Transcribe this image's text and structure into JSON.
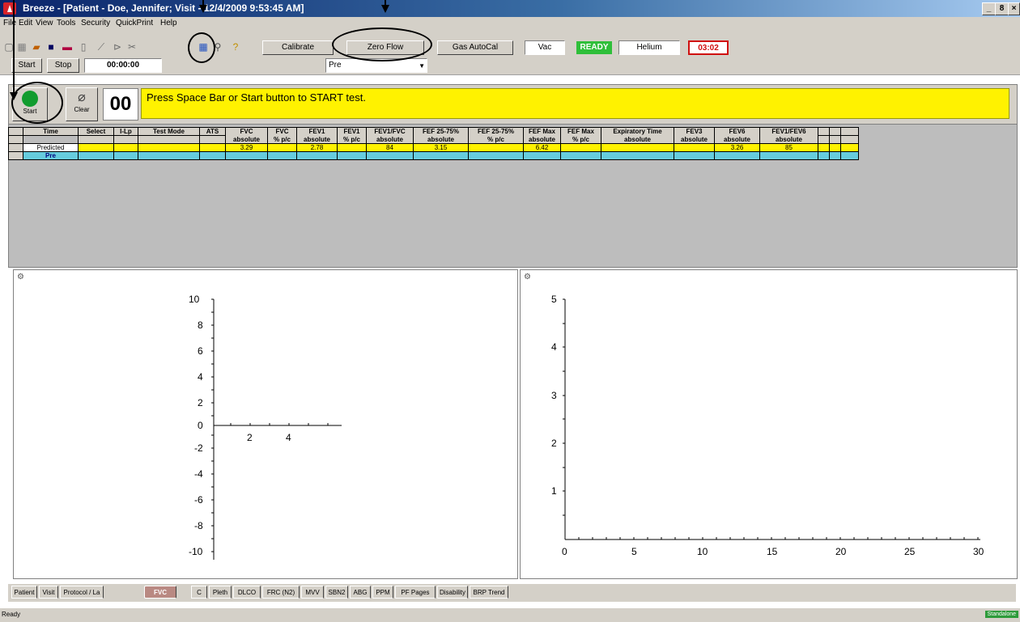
{
  "window": {
    "title": "Breeze - [Patient - Doe, Jennifer; Visit - 12/4/2009 9:53:45 AM]",
    "controls": [
      "_",
      "8",
      "×"
    ]
  },
  "menu": [
    "File",
    "Edit",
    "View",
    "Tools",
    "Security",
    "QuickPrint",
    "Help"
  ],
  "toolbar": {
    "calibrate_label": "Calibrate",
    "zero_flow_label": "Zero Flow",
    "gas_autocal_label": "Gas AutoCal",
    "vac_label": "Vac",
    "ready_label": "READY",
    "helium_label": "Helium",
    "helium_time": "03:02",
    "start_label": "Start",
    "stop_label": "Stop",
    "timer": "00:00:00",
    "phase_select": "Pre"
  },
  "test_bar": {
    "start_label": "Start",
    "clear_label": "Clear",
    "counter": "00",
    "prompt": "Press Space Bar or Start button to START test."
  },
  "table": {
    "header1": [
      "Time",
      "Select",
      "I-Lp",
      "Test Mode",
      "ATS",
      "FVC",
      "FVC",
      "FEV1",
      "FEV1",
      "FEV1/FVC",
      "FEF 25-75%",
      "FEF 25-75%",
      "FEF Max",
      "FEF Max",
      "Expiratory Time",
      "FEV3",
      "FEV6",
      "FEV1/FEV6"
    ],
    "header2": [
      "",
      "",
      "",
      "",
      "",
      "absolute",
      "% p/c",
      "absolute",
      "% p/c",
      "absolute",
      "absolute",
      "% p/c",
      "absolute",
      "% p/c",
      "absolute",
      "absolute",
      "absolute",
      "absolute"
    ],
    "predicted_label": "Predicted",
    "predicted": [
      "",
      "",
      "",
      "",
      "3.29",
      "",
      "2.78",
      "",
      "84",
      "3.15",
      "",
      "6.42",
      "",
      "",
      "",
      "3.26",
      "85"
    ],
    "pre_label": "Pre"
  },
  "left_graph": {
    "y_ticks": [
      "10",
      "8",
      "6",
      "4",
      "2",
      "0",
      "-2",
      "-4",
      "-6",
      "-8",
      "-10"
    ],
    "x_ticks": [
      "2",
      "4"
    ]
  },
  "right_graph": {
    "y_ticks": [
      "5",
      "4",
      "3",
      "2",
      "1"
    ],
    "x_ticks": [
      "0",
      "5",
      "10",
      "15",
      "20",
      "25",
      "30"
    ]
  },
  "tabs": [
    "Patient",
    "Visit",
    "Protocol / La",
    "FVC",
    "C",
    "Pleth",
    "DLCO",
    "FRC (N2)",
    "MVV",
    "SBN2",
    "ABG",
    "PPM",
    "PF Pages",
    "Disability",
    "BRP Trend"
  ],
  "status": {
    "left": "Ready",
    "right": "Standalone"
  },
  "colors": {
    "title_start": "#0a246a",
    "prompt_bg": "#fff200",
    "predicted_bg": "#fff200",
    "pre_bg": "#66ccdd",
    "ready_bg": "#2fbf3a",
    "start_green": "#119c2e",
    "status_green": "#2e9b3b"
  }
}
